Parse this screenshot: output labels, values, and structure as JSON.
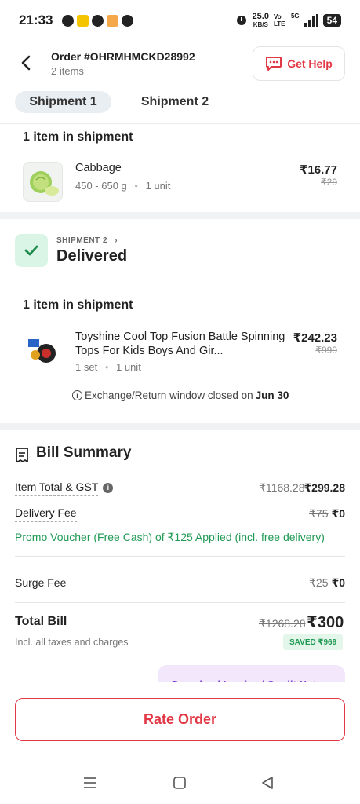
{
  "status_bar": {
    "time": "21:33",
    "net_speed": "25.0",
    "net_unit": "KB/S",
    "volte": "Vo LTE",
    "network": "5G",
    "battery": "54"
  },
  "header": {
    "order_id": "Order #OHRMHMCKD28992",
    "item_count": "2 items",
    "help_label": "Get Help"
  },
  "tabs": [
    "Shipment 1",
    "Shipment 2"
  ],
  "shipment1": {
    "items_heading": "1 item in shipment",
    "item": {
      "name": "Cabbage",
      "weight": "450 - 650 g",
      "quantity": "1 unit",
      "price": "₹16.77",
      "mrp": "₹29"
    }
  },
  "shipment2": {
    "label": "SHIPMENT 2",
    "status": "Delivered",
    "items_heading": "1 item in shipment",
    "item": {
      "name": "Toyshine Cool Top Fusion Battle Spinning Tops For Kids Boys And Gir...",
      "pack": "1 set",
      "quantity": "1 unit",
      "price": "₹242.23",
      "mrp": "₹999"
    },
    "return_note": "Exchange/Return window closed on",
    "return_date": "Jun 30"
  },
  "bill": {
    "title": "Bill Summary",
    "item_total_label": "Item Total & GST",
    "item_total_old": "₹1168.28",
    "item_total_new": "₹299.28",
    "delivery_label": "Delivery Fee",
    "delivery_old": "₹75",
    "delivery_new": "₹0",
    "promo": "Promo Voucher (Free Cash) of ₹125 Applied (incl. free delivery)",
    "surge_label": "Surge Fee",
    "surge_old": "₹25",
    "surge_new": "₹0",
    "total_label": "Total Bill",
    "total_sub": "Incl. all taxes and charges",
    "total_old": "₹1268.28",
    "total_new": "₹300",
    "saved": "SAVED ₹969",
    "invoice_label": "Download Invoice / Credit Note"
  },
  "actions": {
    "rate_label": "Rate Order"
  },
  "colors": {
    "accent": "#e23744",
    "success": "#1f9a54",
    "tab_bg": "#e9eef3"
  },
  "icons": {
    "back": "arrow-left-icon",
    "help": "chat-icon",
    "check": "check-icon",
    "receipt": "receipt-icon",
    "info": "info-icon"
  }
}
